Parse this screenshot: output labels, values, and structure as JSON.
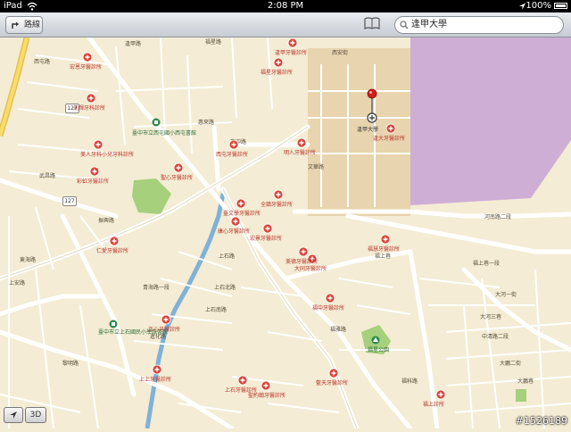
{
  "status_bar": {
    "carrier": "iPad",
    "time": "2:08 PM",
    "battery": "100%"
  },
  "toolbar": {
    "route_label": "路線",
    "search_value": "逢甲大學"
  },
  "map": {
    "streets": [
      "西屯路",
      "逢甲路",
      "西安街",
      "文華路",
      "福星路",
      "河南路二段",
      "上石路",
      "青海路一段",
      "上安路",
      "上石北路",
      "上石南路",
      "大河一街",
      "大河三巷",
      "東海路",
      "福上巷",
      "進化路",
      "武昌路",
      "惠來路",
      "惠中路",
      "中清路二段",
      "黎明路",
      "福科路",
      "福雅路",
      "振興路",
      "福上巷一段",
      "大鵬二街",
      "大鵬巷",
      "臺中市西屯區西屯國小",
      "惠文高中"
    ],
    "routes": [
      "127",
      "127"
    ],
    "places": [
      "逢甲大學",
      "臺中市立西屯國小西屯書館",
      "臺中市立上石國民小學館書館",
      "福星公園"
    ],
    "pois": [
      "逢甲牙醫診所",
      "宏恩牙醫診所",
      "福星牙醫診所",
      "光輝牙科診所",
      "西屯牙醫診所",
      "明人牙醫診所",
      "美人牙科小兒牙科診所",
      "聖心牙醫診所",
      "彩虹牙醫診所",
      "臺文學牙醫診所",
      "全鎮牙醫診所",
      "康心牙醫診所",
      "宏景牙醫診所",
      "逢大牙醫診所",
      "仁愛牙醫診所",
      "美德牙醫診所",
      "福慧牙醫診所",
      "大同牙醫診所",
      "正心牙醫診所",
      "福中牙醫診所",
      "上石牙醫診所",
      "聖約翰牙醫診所",
      "上上牙醫診所",
      "藍天牙醫診所",
      "福上診所"
    ]
  },
  "bottom": {
    "locate_icon": "location-arrow-icon",
    "view_3d": "3D"
  },
  "watermark": "#1526189"
}
